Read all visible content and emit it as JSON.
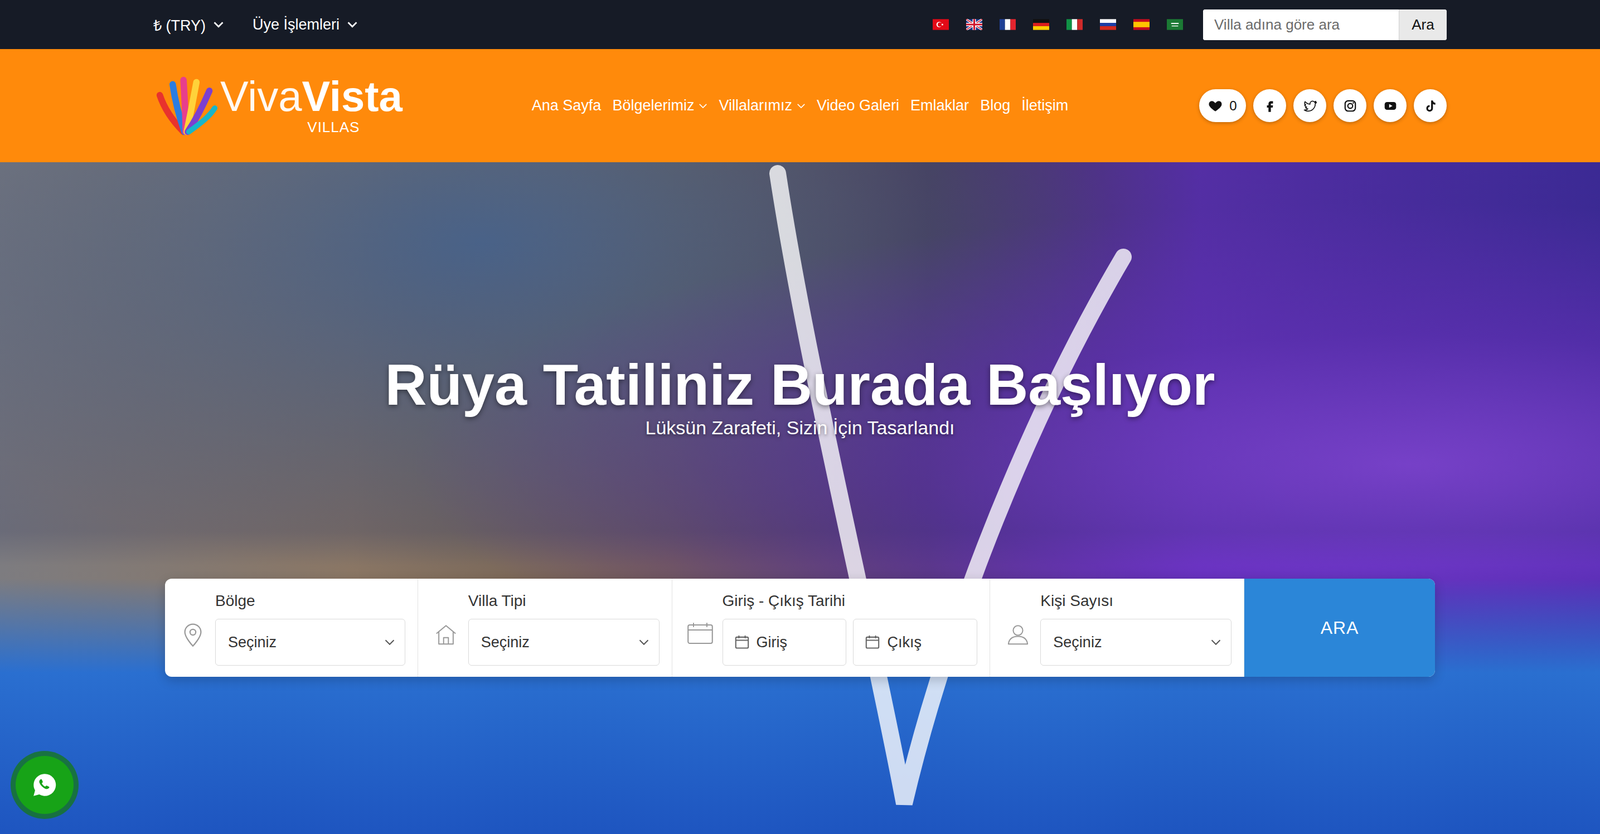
{
  "topbar": {
    "currency": "₺ (TRY)",
    "member_menu": "Üye İşlemleri",
    "search": {
      "placeholder": "Villa adına göre ara",
      "button": "Ara"
    }
  },
  "logo": {
    "name_light": "Viva",
    "name_bold": "Vista",
    "subtitle": "VILLAS"
  },
  "nav": [
    {
      "label": "Ana Sayfa",
      "dropdown": false
    },
    {
      "label": "Bölgelerimiz",
      "dropdown": true
    },
    {
      "label": "Villalarımız",
      "dropdown": true
    },
    {
      "label": "Video Galeri",
      "dropdown": false
    },
    {
      "label": "Emlaklar",
      "dropdown": false
    },
    {
      "label": "Blog",
      "dropdown": false
    },
    {
      "label": "İletişim",
      "dropdown": false
    }
  ],
  "favorites": {
    "count": "0"
  },
  "hero": {
    "title": "Rüya Tatiliniz Burada Başlıyor",
    "subtitle": "Lüksün Zarafeti, Sizin İçin Tasarlandı"
  },
  "search_form": {
    "fields": [
      {
        "kind": "select",
        "label": "Bölge",
        "value": "Seçiniz"
      },
      {
        "kind": "select",
        "label": "Villa Tipi",
        "value": "Seçiniz"
      },
      {
        "kind": "dates",
        "label": "Giriş - Çıkış Tarihi",
        "inputs": [
          "Giriş",
          "Çıkış"
        ]
      },
      {
        "kind": "select",
        "label": "Kişi Sayısı",
        "value": "Seçiniz"
      }
    ],
    "button": "ARA"
  }
}
